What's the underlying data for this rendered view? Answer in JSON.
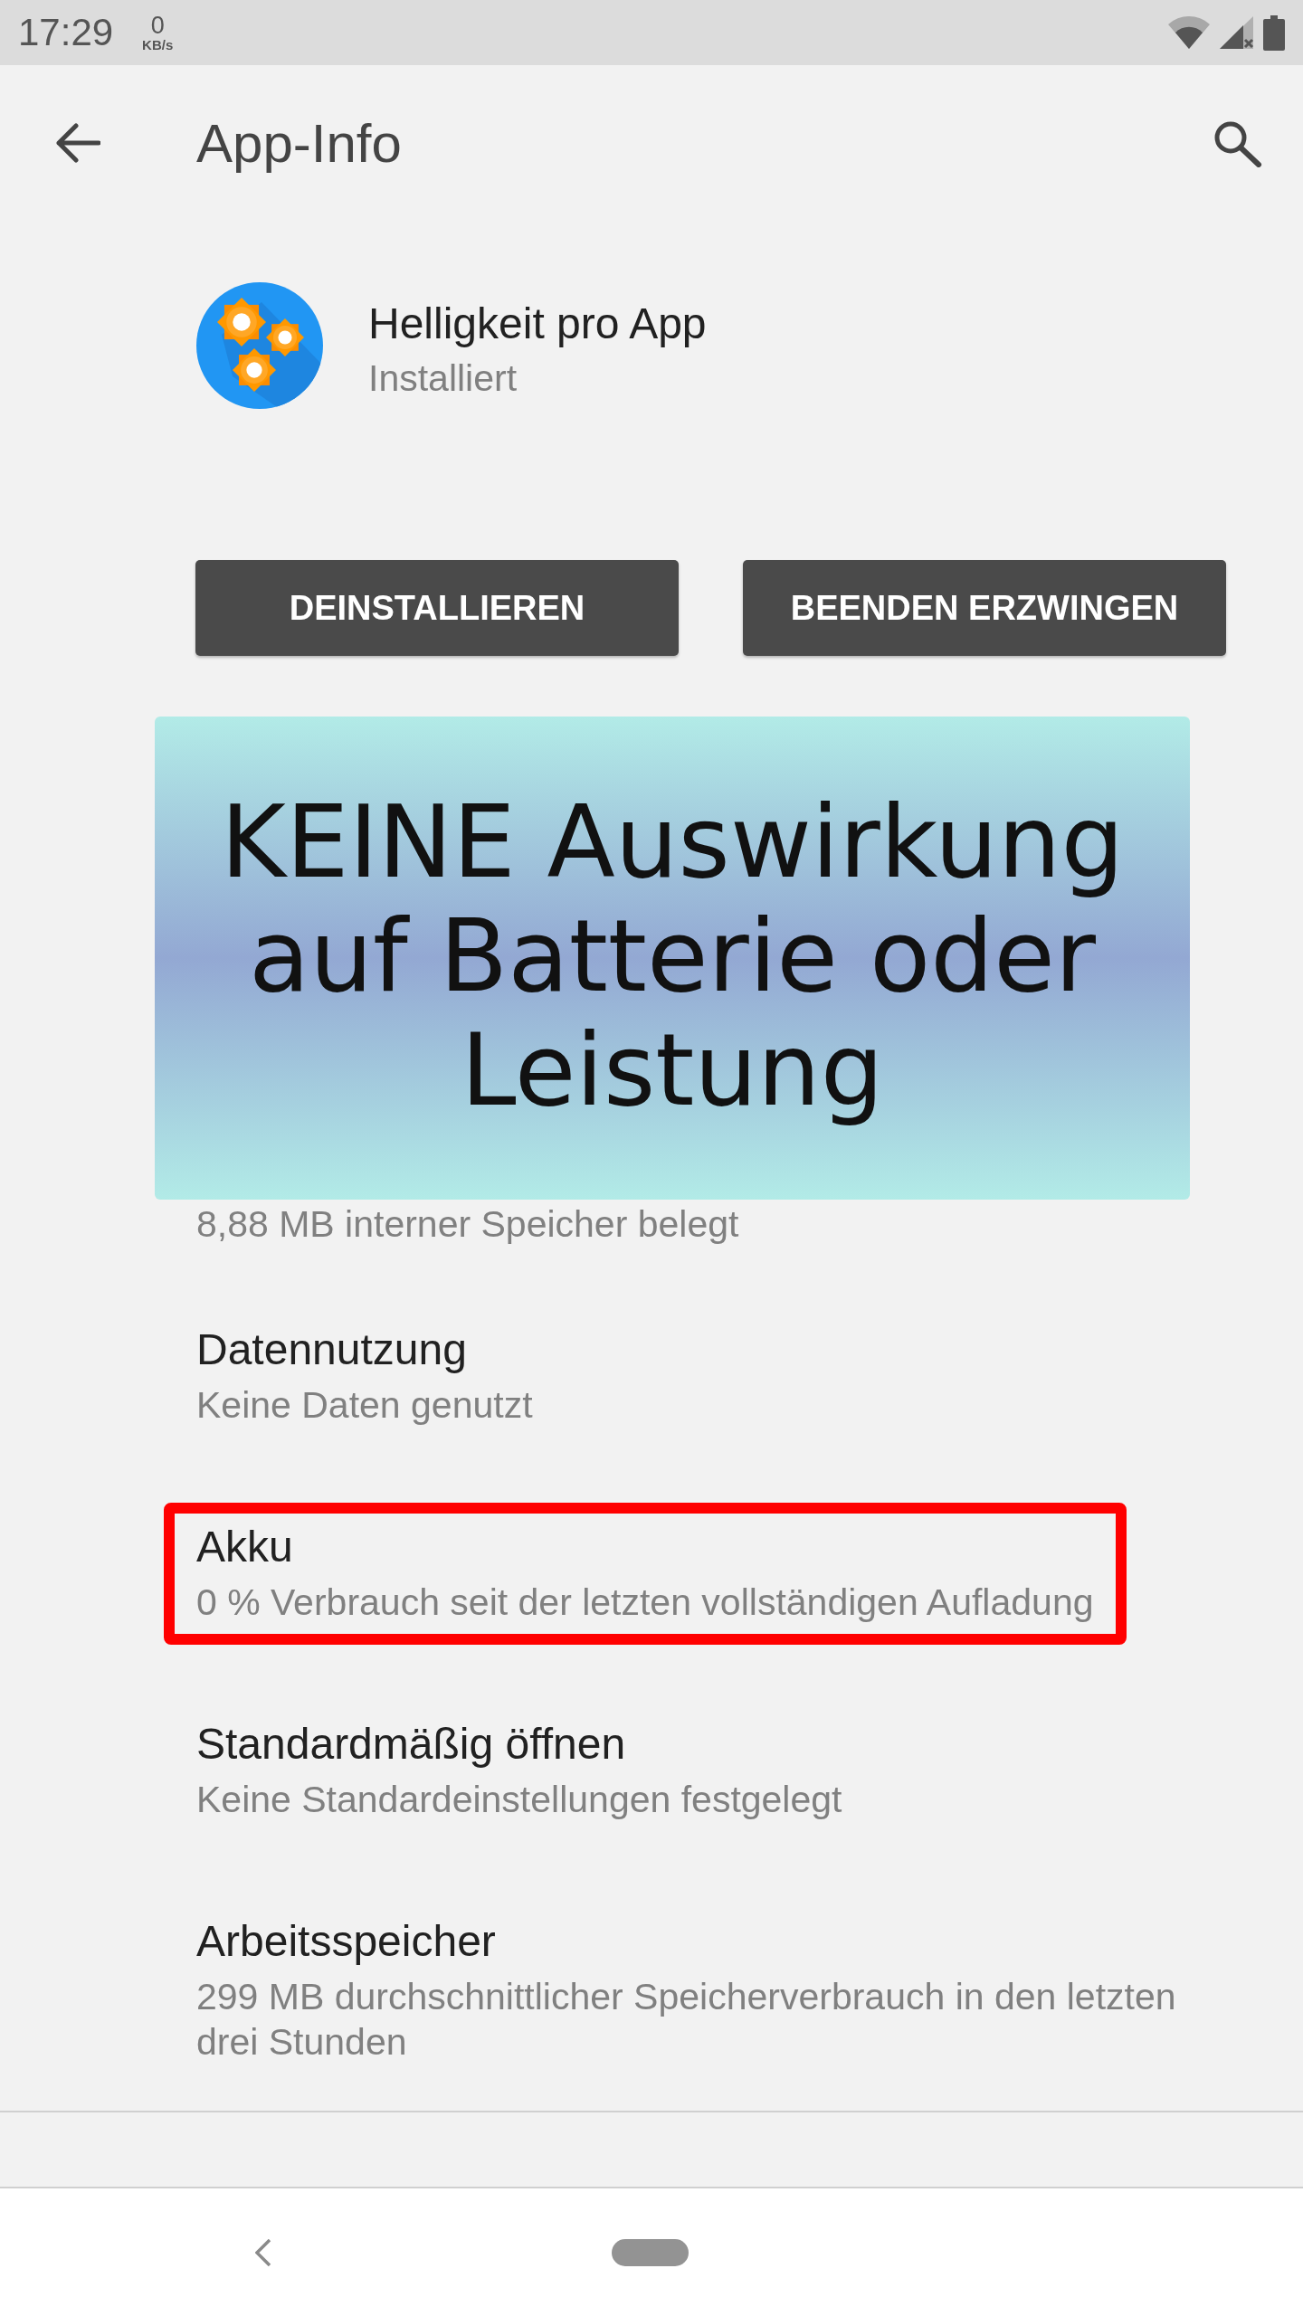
{
  "status_bar": {
    "time": "17:29",
    "data_rate": "0",
    "data_rate_unit": "KB/s"
  },
  "toolbar": {
    "title": "App-Info"
  },
  "app": {
    "name": "Helligkeit pro App",
    "status": "Installiert"
  },
  "buttons": [
    {
      "label": "DEINSTALLIEREN"
    },
    {
      "label": "BEENDEN ERZWINGEN"
    }
  ],
  "overlay_banner": {
    "text": "KEINE Auswirkung auf Batterie oder Leistung"
  },
  "partial_item": {
    "summary": "8,88 MB interner Speicher belegt"
  },
  "settings": [
    {
      "title": "Datennutzung",
      "summary": "Keine Daten genutzt",
      "highlighted": false
    },
    {
      "title": "Akku",
      "summary": "0 % Verbrauch seit der letzten vollständigen Aufladung",
      "highlighted": true
    },
    {
      "title": "Standardmäßig öffnen",
      "summary": "Keine Standardeinstellungen festgelegt",
      "highlighted": false
    },
    {
      "title": "Arbeitsspeicher",
      "summary": "299 MB durchschnittlicher Speicherverbrauch in den letzten drei Stunden",
      "highlighted": false
    }
  ]
}
